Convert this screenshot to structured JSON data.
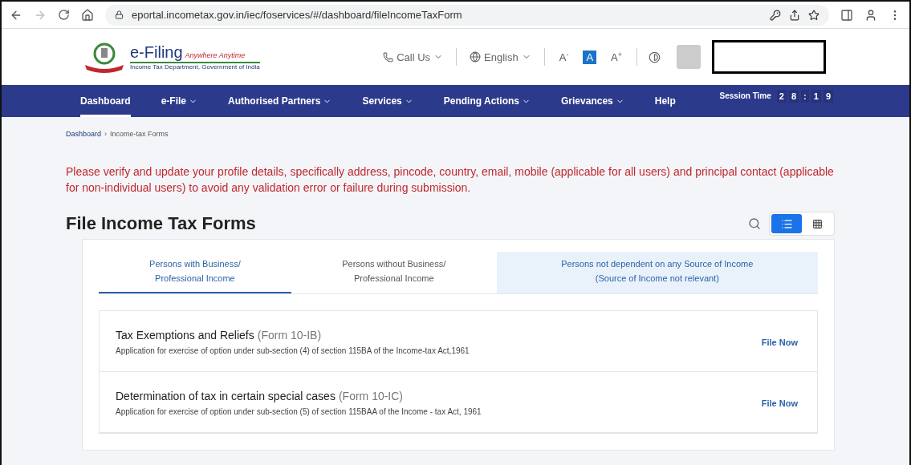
{
  "browser": {
    "url": "eportal.incometax.gov.in/iec/foservices/#/dashboard/fileIncomeTaxForm"
  },
  "header": {
    "logo_title": "e-Filing",
    "logo_tagline": "Anywhere Anytime",
    "logo_subtitle": "Income Tax Department, Government of India",
    "call_us": "Call Us",
    "language": "English",
    "font_sizes": [
      {
        "label": "A",
        "sign": "-",
        "selected": false
      },
      {
        "label": "A",
        "selected": true
      },
      {
        "label": "A",
        "sign": "+",
        "selected": false
      }
    ]
  },
  "nav": {
    "items": [
      {
        "label": "Dashboard",
        "dropdown": false,
        "selected": true
      },
      {
        "label": "e-File",
        "dropdown": true,
        "selected": false
      },
      {
        "label": "Authorised Partners",
        "dropdown": true,
        "selected": false
      },
      {
        "label": "Services",
        "dropdown": true,
        "selected": false
      },
      {
        "label": "Pending Actions",
        "dropdown": true,
        "selected": false
      },
      {
        "label": "Grievances",
        "dropdown": true,
        "selected": false
      },
      {
        "label": "Help",
        "dropdown": false,
        "selected": false
      }
    ],
    "session_label": "Session Time",
    "session_digits": [
      "2",
      "8",
      ":",
      "1",
      "9"
    ]
  },
  "breadcrumb": {
    "separator": "›",
    "items": [
      "Dashboard",
      "Income-tax Forms"
    ]
  },
  "notice": "Please verify and update your profile details, specifically address, pincode, country, email, mobile (applicable for all users) and principal contact (applicable for non-individual users) to avoid any validation error or failure during submission.",
  "page_title": "File Income Tax Forms",
  "view_toggle": [
    {
      "kind": "list",
      "selected": true
    },
    {
      "kind": "grid",
      "selected": false
    }
  ],
  "tabs": [
    {
      "line1": "Persons with Business/",
      "line2": "Professional Income",
      "selected": true
    },
    {
      "line1": "Persons without Business/",
      "line2": "Professional Income",
      "selected": false
    },
    {
      "line1": "Persons not dependent on any Source of Income",
      "line2": "(Source of Income not relevant)",
      "selected": false
    }
  ],
  "forms": [
    {
      "title": "Tax Exemptions and Reliefs",
      "form": "(Form 10-IB)",
      "description": "Application for exercise of option under sub-section (4) of section 115BA of the Income-tax Act,1961",
      "action": "File Now"
    },
    {
      "title": "Determination of tax in certain special cases",
      "form": "(Form 10-IC)",
      "description": "Application for exercise of option under sub-section (5) of section 115BAA of the Income - tax Act, 1961",
      "action": "File Now"
    }
  ]
}
